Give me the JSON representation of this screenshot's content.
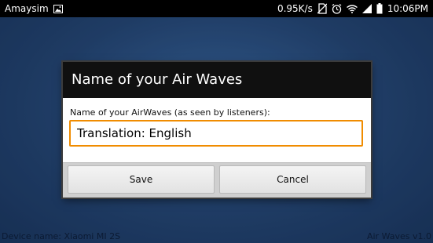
{
  "status_bar": {
    "carrier": "Amaysim",
    "speed": "0.95K/s",
    "time": "10:06PM",
    "icons": [
      "gallery-icon",
      "no-sim-icon",
      "alarm-icon",
      "wifi-icon",
      "signal-icon",
      "battery-icon"
    ]
  },
  "dialog": {
    "title": "Name of your Air Waves",
    "field_label": "Name of your AirWaves (as seen by listeners):",
    "field_value": "Translation: English",
    "save_label": "Save",
    "cancel_label": "Cancel",
    "accent_color": "#f08c00"
  },
  "footer": {
    "device_name": "Device name: Xiaomi MI 2S",
    "app_version": "Air Waves v1.0"
  }
}
